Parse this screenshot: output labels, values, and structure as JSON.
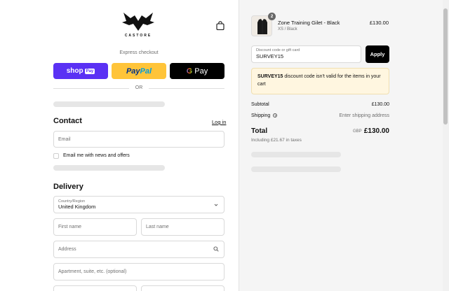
{
  "brand": {
    "name": "CASTORE"
  },
  "express": {
    "label": "Express checkout",
    "shop_pay": {
      "text": "shop",
      "badge": "Pay"
    },
    "paypal": {
      "part1": "Pay",
      "part2": "Pal"
    },
    "gpay": {
      "g": "G",
      "text": "Pay"
    },
    "or_text": "OR"
  },
  "contact": {
    "title": "Contact",
    "login_label": "Log in",
    "email_placeholder": "Email",
    "newsletter_label": "Email me with news and offers"
  },
  "delivery": {
    "title": "Delivery",
    "country_label": "Country/Region",
    "country_value": "United Kingdom",
    "first_name_placeholder": "First name",
    "last_name_placeholder": "Last name",
    "address_placeholder": "Address",
    "apartment_placeholder": "Apartment, suite, etc. (optional)"
  },
  "cart": {
    "item": {
      "quantity": "2",
      "name": "Zone Training Gilet - Black",
      "variant": "XS / Black",
      "price": "£130.00"
    },
    "discount": {
      "label": "Discount code or gift card",
      "value": "SURVEY15",
      "apply_label": "Apply"
    },
    "warning": {
      "code": "SURVEY15",
      "message": " discount code isn't valid for the items in your cart"
    },
    "subtotal_label": "Subtotal",
    "subtotal_value": "£130.00",
    "shipping_label": "Shipping",
    "shipping_value": "Enter shipping address",
    "total_label": "Total",
    "total_currency": "GBP",
    "total_value": "£130.00",
    "tax_note": "Including £21.67 in taxes"
  },
  "colors": {
    "shop_pay": "#5a31f4",
    "paypal": "#ffc439",
    "gpay": "#000000",
    "warning_bg": "#fff6e0",
    "summary_bg": "#f5f5f5"
  },
  "icons": [
    "castore-logo-icon",
    "shopping-bag-icon",
    "chevron-down-icon",
    "search-icon",
    "info-icon"
  ]
}
